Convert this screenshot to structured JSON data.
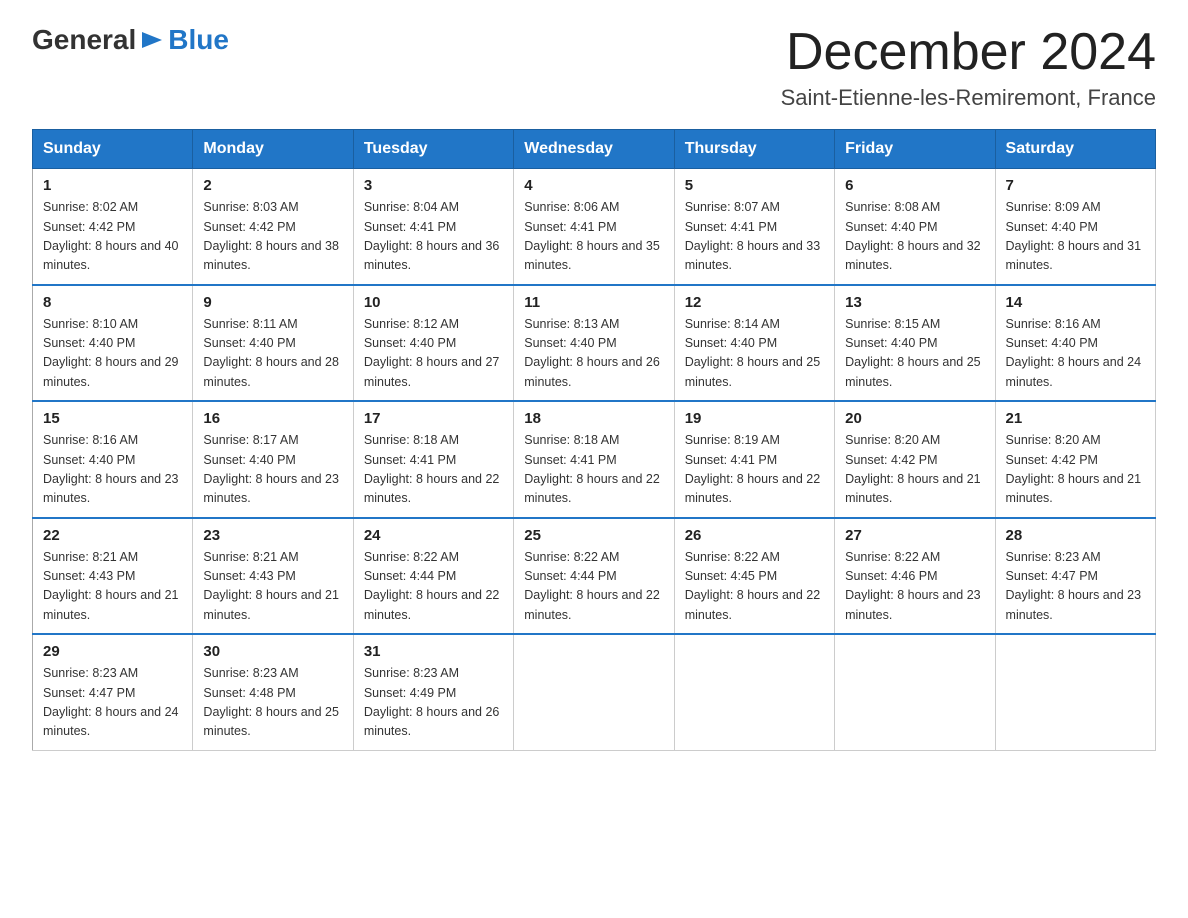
{
  "header": {
    "logo_general": "General",
    "logo_blue": "Blue",
    "month_title": "December 2024",
    "location": "Saint-Etienne-les-Remiremont, France"
  },
  "days_of_week": [
    "Sunday",
    "Monday",
    "Tuesday",
    "Wednesday",
    "Thursday",
    "Friday",
    "Saturday"
  ],
  "weeks": [
    [
      {
        "day": "1",
        "sunrise": "8:02 AM",
        "sunset": "4:42 PM",
        "daylight": "8 hours and 40 minutes."
      },
      {
        "day": "2",
        "sunrise": "8:03 AM",
        "sunset": "4:42 PM",
        "daylight": "8 hours and 38 minutes."
      },
      {
        "day": "3",
        "sunrise": "8:04 AM",
        "sunset": "4:41 PM",
        "daylight": "8 hours and 36 minutes."
      },
      {
        "day": "4",
        "sunrise": "8:06 AM",
        "sunset": "4:41 PM",
        "daylight": "8 hours and 35 minutes."
      },
      {
        "day": "5",
        "sunrise": "8:07 AM",
        "sunset": "4:41 PM",
        "daylight": "8 hours and 33 minutes."
      },
      {
        "day": "6",
        "sunrise": "8:08 AM",
        "sunset": "4:40 PM",
        "daylight": "8 hours and 32 minutes."
      },
      {
        "day": "7",
        "sunrise": "8:09 AM",
        "sunset": "4:40 PM",
        "daylight": "8 hours and 31 minutes."
      }
    ],
    [
      {
        "day": "8",
        "sunrise": "8:10 AM",
        "sunset": "4:40 PM",
        "daylight": "8 hours and 29 minutes."
      },
      {
        "day": "9",
        "sunrise": "8:11 AM",
        "sunset": "4:40 PM",
        "daylight": "8 hours and 28 minutes."
      },
      {
        "day": "10",
        "sunrise": "8:12 AM",
        "sunset": "4:40 PM",
        "daylight": "8 hours and 27 minutes."
      },
      {
        "day": "11",
        "sunrise": "8:13 AM",
        "sunset": "4:40 PM",
        "daylight": "8 hours and 26 minutes."
      },
      {
        "day": "12",
        "sunrise": "8:14 AM",
        "sunset": "4:40 PM",
        "daylight": "8 hours and 25 minutes."
      },
      {
        "day": "13",
        "sunrise": "8:15 AM",
        "sunset": "4:40 PM",
        "daylight": "8 hours and 25 minutes."
      },
      {
        "day": "14",
        "sunrise": "8:16 AM",
        "sunset": "4:40 PM",
        "daylight": "8 hours and 24 minutes."
      }
    ],
    [
      {
        "day": "15",
        "sunrise": "8:16 AM",
        "sunset": "4:40 PM",
        "daylight": "8 hours and 23 minutes."
      },
      {
        "day": "16",
        "sunrise": "8:17 AM",
        "sunset": "4:40 PM",
        "daylight": "8 hours and 23 minutes."
      },
      {
        "day": "17",
        "sunrise": "8:18 AM",
        "sunset": "4:41 PM",
        "daylight": "8 hours and 22 minutes."
      },
      {
        "day": "18",
        "sunrise": "8:18 AM",
        "sunset": "4:41 PM",
        "daylight": "8 hours and 22 minutes."
      },
      {
        "day": "19",
        "sunrise": "8:19 AM",
        "sunset": "4:41 PM",
        "daylight": "8 hours and 22 minutes."
      },
      {
        "day": "20",
        "sunrise": "8:20 AM",
        "sunset": "4:42 PM",
        "daylight": "8 hours and 21 minutes."
      },
      {
        "day": "21",
        "sunrise": "8:20 AM",
        "sunset": "4:42 PM",
        "daylight": "8 hours and 21 minutes."
      }
    ],
    [
      {
        "day": "22",
        "sunrise": "8:21 AM",
        "sunset": "4:43 PM",
        "daylight": "8 hours and 21 minutes."
      },
      {
        "day": "23",
        "sunrise": "8:21 AM",
        "sunset": "4:43 PM",
        "daylight": "8 hours and 21 minutes."
      },
      {
        "day": "24",
        "sunrise": "8:22 AM",
        "sunset": "4:44 PM",
        "daylight": "8 hours and 22 minutes."
      },
      {
        "day": "25",
        "sunrise": "8:22 AM",
        "sunset": "4:44 PM",
        "daylight": "8 hours and 22 minutes."
      },
      {
        "day": "26",
        "sunrise": "8:22 AM",
        "sunset": "4:45 PM",
        "daylight": "8 hours and 22 minutes."
      },
      {
        "day": "27",
        "sunrise": "8:22 AM",
        "sunset": "4:46 PM",
        "daylight": "8 hours and 23 minutes."
      },
      {
        "day": "28",
        "sunrise": "8:23 AM",
        "sunset": "4:47 PM",
        "daylight": "8 hours and 23 minutes."
      }
    ],
    [
      {
        "day": "29",
        "sunrise": "8:23 AM",
        "sunset": "4:47 PM",
        "daylight": "8 hours and 24 minutes."
      },
      {
        "day": "30",
        "sunrise": "8:23 AM",
        "sunset": "4:48 PM",
        "daylight": "8 hours and 25 minutes."
      },
      {
        "day": "31",
        "sunrise": "8:23 AM",
        "sunset": "4:49 PM",
        "daylight": "8 hours and 26 minutes."
      },
      null,
      null,
      null,
      null
    ]
  ]
}
